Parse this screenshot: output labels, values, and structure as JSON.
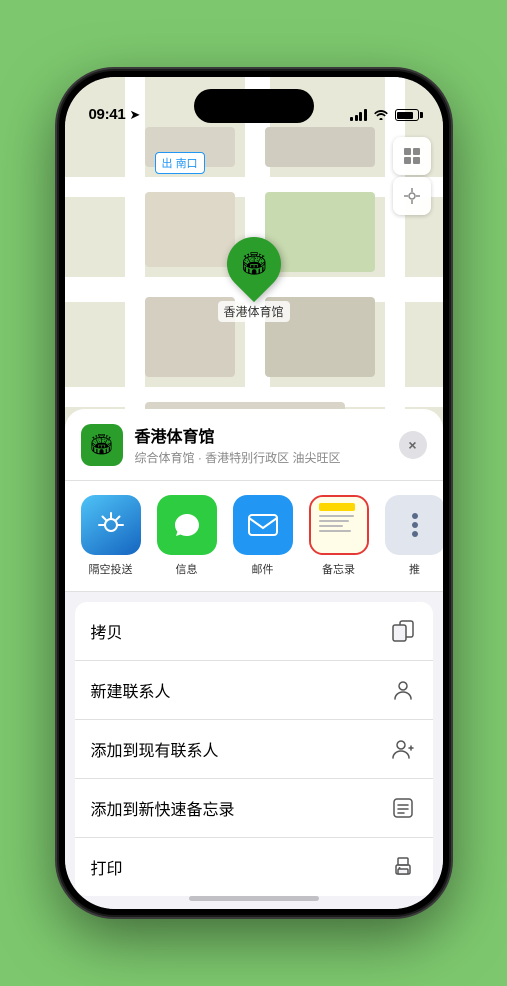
{
  "phone": {
    "status_bar": {
      "time": "09:41",
      "location_arrow": "▶"
    }
  },
  "map": {
    "label": "南口",
    "label_prefix": "出"
  },
  "pin": {
    "label": "香港体育馆"
  },
  "sheet": {
    "venue_name": "香港体育馆",
    "venue_subtitle": "综合体育馆 · 香港特别行政区 油尖旺区",
    "close_label": "×"
  },
  "share_items": [
    {
      "id": "airdrop",
      "label": "隔空投送",
      "emoji": "📡"
    },
    {
      "id": "messages",
      "label": "信息",
      "emoji": "💬"
    },
    {
      "id": "mail",
      "label": "邮件",
      "emoji": "✉️"
    },
    {
      "id": "notes",
      "label": "备忘录",
      "emoji": "notes"
    },
    {
      "id": "more",
      "label": "推",
      "emoji": "···"
    }
  ],
  "actions": [
    {
      "id": "copy",
      "label": "拷贝",
      "icon": "copy"
    },
    {
      "id": "new-contact",
      "label": "新建联系人",
      "icon": "person"
    },
    {
      "id": "add-existing",
      "label": "添加到现有联系人",
      "icon": "person-add"
    },
    {
      "id": "add-notes",
      "label": "添加到新快速备忘录",
      "icon": "notes-add"
    },
    {
      "id": "print",
      "label": "打印",
      "icon": "print"
    }
  ],
  "colors": {
    "green": "#2a9d2a",
    "blue": "#2196F3",
    "red": "#e53935",
    "bg": "#f2f2f7"
  }
}
